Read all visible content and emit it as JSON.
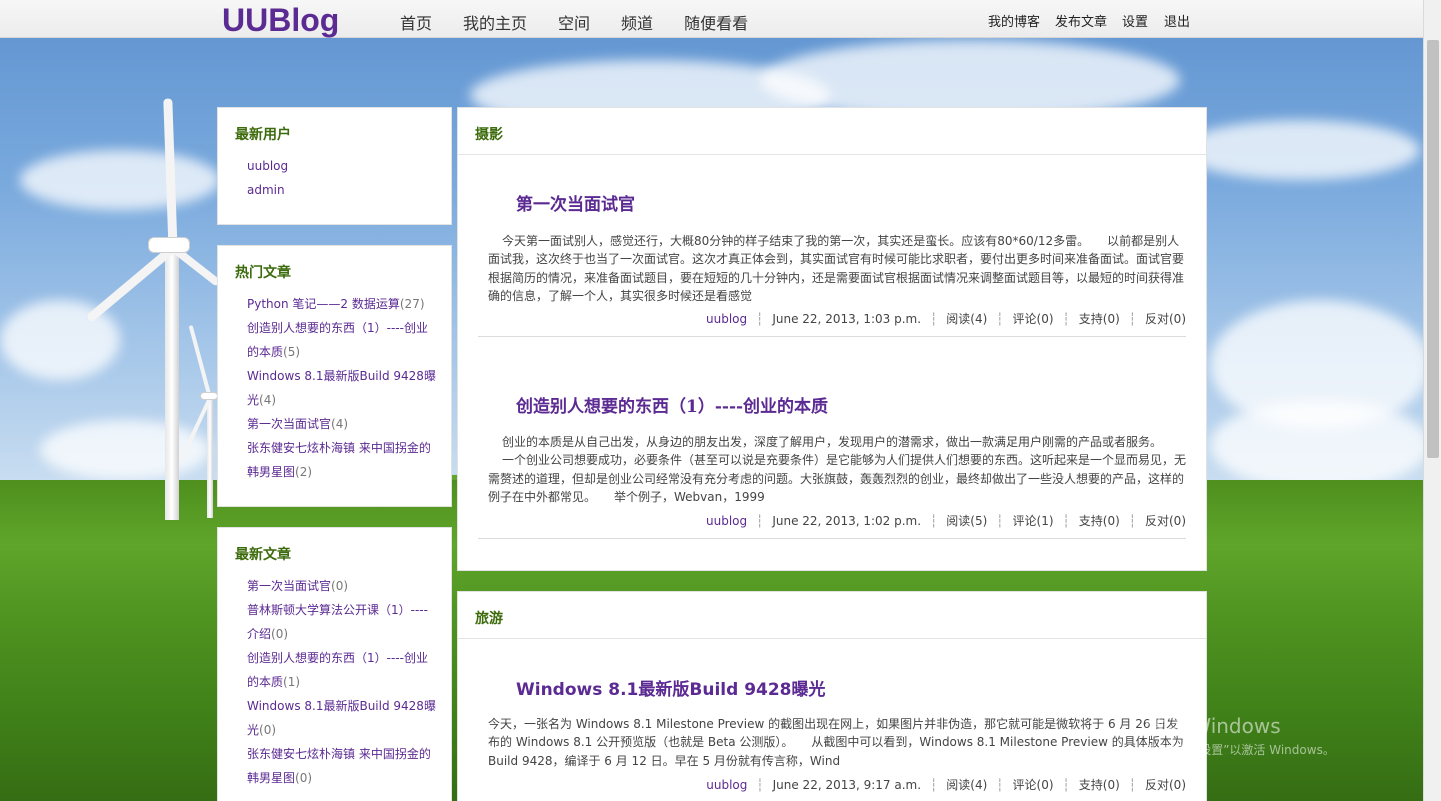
{
  "site": {
    "logo": "UUBlog",
    "main_nav": [
      "首页",
      "我的主页",
      "空间",
      "频道",
      "随便看看"
    ],
    "user_nav": [
      "我的博客",
      "发布文章",
      "设置",
      "退出"
    ]
  },
  "sidebar": {
    "new_users": {
      "title": "最新用户",
      "items": [
        "uublog",
        "admin"
      ]
    },
    "hot_articles": {
      "title": "热门文章",
      "items": [
        {
          "line1": "Python 笔记——2 数据运算",
          "line2": "",
          "count": "(27)"
        },
        {
          "line1": "创造别人想要的东西（1）----创业",
          "line2": "的本质",
          "count": "(5)"
        },
        {
          "line1": "Windows 8.1最新版Build 9428曝",
          "line2": "光",
          "count": "(4)"
        },
        {
          "line1": "第一次当面试官",
          "line2": "",
          "count": "(4)"
        },
        {
          "line1": "张东健安七炫朴海镇 来中国拐金的",
          "line2": "韩男星图",
          "count": "(2)"
        }
      ]
    },
    "recent_articles": {
      "title": "最新文章",
      "items": [
        {
          "line1": "第一次当面试官",
          "line2": "",
          "count": "(0)"
        },
        {
          "line1": "普林斯顿大学算法公开课（1）----",
          "line2": "介绍",
          "count": "(0)"
        },
        {
          "line1": "创造别人想要的东西（1）----创业",
          "line2": "的本质",
          "count": "(1)"
        },
        {
          "line1": "Windows 8.1最新版Build 9428曝",
          "line2": "光",
          "count": "(0)"
        },
        {
          "line1": "张东健安七炫朴海镇 来中国拐金的",
          "line2": "韩男星图",
          "count": "(0)"
        }
      ]
    }
  },
  "sections": [
    {
      "title": "摄影",
      "posts": [
        {
          "title": "第一次当面试官",
          "body": "今天第一面试别人，感觉还行，大概80分钟的样子结束了我的第一次，其实还是蛮长。应该有80*60/12多雷。　　以前都是别人面试我，这次终于也当了一次面试官。这次才真正体会到，其实面试官有时候可能比求职者，要付出更多时间来准备面试。面试官要根据简历的情况，来准备面试题目，要在短短的几十分钟内，还是需要面试官根据面试情况来调整面试题目等，以最短的时间获得准确的信息，了解一个人，其实很多时候还是看感觉",
          "author": "uublog",
          "date": "June 22, 2013, 1:03 p.m.",
          "reads": "阅读(4)",
          "comments": "评论(0)",
          "support": "支持(0)",
          "oppose": "反对(0)"
        },
        {
          "title": "创造别人想要的东西（1）----创业的本质",
          "body_lines": [
            "创业的本质是从自己出发，从身边的朋友出发，深度了解用户，发现用户的潜需求，做出一款满足用户刚需的产品或者服务。",
            "一个创业公司想要成功，必要条件（甚至可以说是充要条件）是它能够为人们提供人们想要的东西。这听起来是一个显而易见，无需赘述的道理，但却是创业公司经常没有充分考虑的问题。大张旗鼓，轰轰烈烈的创业，最终却做出了一些没人想要的产品，这样的例子在中外都常见。　　举个例子，Webvan，1999"
          ],
          "author": "uublog",
          "date": "June 22, 2013, 1:02 p.m.",
          "reads": "阅读(5)",
          "comments": "评论(1)",
          "support": "支持(0)",
          "oppose": "反对(0)"
        }
      ]
    },
    {
      "title": "旅游",
      "posts": [
        {
          "title": "Windows 8.1最新版Build 9428曝光",
          "body": "今天，一张名为 Windows 8.1 Milestone Preview 的截图出现在网上，如果图片并非伪造，那它就可能是微软将于 6 月 26 日发布的 Windows 8.1 公开预览版（也就是 Beta 公测版）。　　从截图中可以看到，Windows 8.1 Milestone Preview 的具体版本为 Build 9428，编译于 6 月 12 日。早在 5 月份就有传言称，Wind",
          "author": "uublog",
          "date": "June 22, 2013, 9:17 a.m.",
          "reads": "阅读(4)",
          "comments": "评论(0)",
          "support": "支持(0)",
          "oppose": "反对(0)"
        }
      ]
    }
  ],
  "watermark": {
    "line1": "激活 Windows",
    "line2": "转到“电脑设置”以激活 Windows。"
  },
  "colors": {
    "accent": "#5b2a92",
    "heading_green": "#3c6b0c"
  },
  "icons": [
    "scrollbar"
  ]
}
